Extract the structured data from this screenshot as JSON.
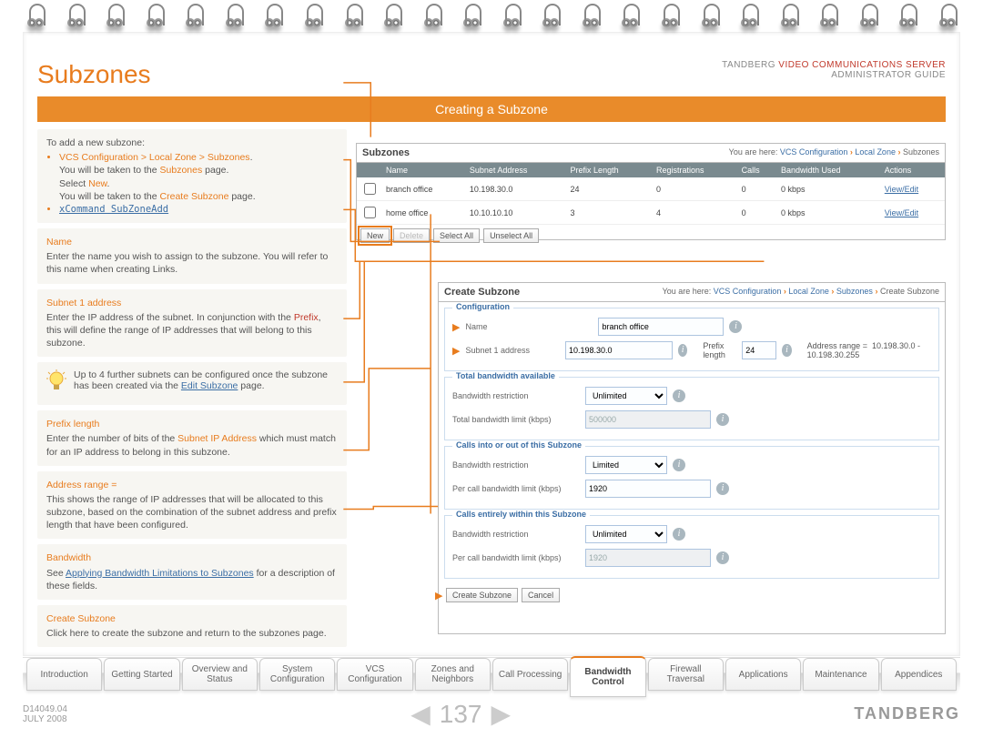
{
  "header": {
    "title": "Subzones",
    "product_line1a": "TANDBERG ",
    "product_line1b": "VIDEO COMMUNICATIONS SERVER",
    "product_line2": "ADMINISTRATOR GUIDE"
  },
  "banner": "Creating a Subzone",
  "intro": {
    "lead": "To add a new subzone:",
    "nav_path": "VCS Configuration > Local Zone > Subzones",
    "nav_path_after": ".",
    "line2a": "You will be taken to the ",
    "line2b": "Subzones",
    "line2c": " page.",
    "line3a": "Select ",
    "line3b": "New",
    "line3c": ".",
    "line4a": "You will be taken to the ",
    "line4b": "Create Subzone",
    "line4c": " page.",
    "xcommand": "xCommand SubZoneAdd"
  },
  "sections": {
    "name": {
      "title": "Name",
      "body": "Enter the name you wish to assign to the subzone.  You will refer to this name when creating Links."
    },
    "subnet": {
      "title": "Subnet 1 address",
      "body_a": "Enter the IP address of the subnet.  In conjunction with the ",
      "body_b": "Prefix",
      "body_c": ", this will define the range of IP addresses that will belong to this subzone."
    },
    "tip": {
      "body_a": "Up to 4 further subnets can be configured once the subzone has been created via the ",
      "body_link": "Edit Subzone",
      "body_b": " page."
    },
    "prefix": {
      "title": "Prefix length",
      "body_a": "Enter the number of bits of the ",
      "body_b": "Subnet IP Address",
      "body_c": " which must match for an IP address to belong in this subzone."
    },
    "range": {
      "title": "Address range =",
      "body": "This shows the range of IP addresses that will be allocated to this subzone, based on the combination of the subnet address and prefix length that have been configured."
    },
    "bandwidth": {
      "title": "Bandwidth",
      "body_a": "See ",
      "body_link": "Applying Bandwidth Limitations to Subzones",
      "body_b": " for a description of these fields."
    },
    "create": {
      "title": "Create Subzone",
      "body": "Click here to create the subzone and return to the subzones page."
    }
  },
  "panel_list": {
    "title": "Subzones",
    "crumb_prefix": "You are here: ",
    "crumb": [
      "VCS Configuration",
      "Local Zone",
      "Subzones"
    ],
    "cols": [
      "Name",
      "Subnet Address",
      "Prefix Length",
      "Registrations",
      "Calls",
      "Bandwidth Used",
      "Actions"
    ],
    "rows": [
      {
        "name": "branch office",
        "subnet": "10.198.30.0",
        "prefix": "24",
        "reg": "0",
        "calls": "0",
        "bw": "0 kbps",
        "action": "View/Edit"
      },
      {
        "name": "home office",
        "subnet": "10.10.10.10",
        "prefix": "3",
        "reg": "4",
        "calls": "0",
        "bw": "0 kbps",
        "action": "View/Edit"
      }
    ],
    "buttons": {
      "new": "New",
      "delete": "Delete",
      "select_all": "Select All",
      "unselect_all": "Unselect All"
    }
  },
  "panel_form": {
    "title": "Create Subzone",
    "crumb_prefix": "You are here: ",
    "crumb": [
      "VCS Configuration",
      "Local Zone",
      "Subzones",
      "Create Subzone"
    ],
    "groups": {
      "config": {
        "legend": "Configuration",
        "name_label": "Name",
        "name_value": "branch office",
        "subnet_label": "Subnet 1 address",
        "subnet_value": "10.198.30.0",
        "prefix_label": "Prefix length",
        "prefix_value": "24",
        "addr_label": "Address range =",
        "addr_value": "10.198.30.0 - 10.198.30.255"
      },
      "total": {
        "legend": "Total bandwidth available",
        "restrict_label": "Bandwidth restriction",
        "restrict_value": "Unlimited",
        "limit_label": "Total bandwidth limit (kbps)",
        "limit_value": "500000"
      },
      "calls_io": {
        "legend": "Calls into or out of this Subzone",
        "restrict_label": "Bandwidth restriction",
        "restrict_value": "Limited",
        "limit_label": "Per call bandwidth limit (kbps)",
        "limit_value": "1920"
      },
      "calls_within": {
        "legend": "Calls entirely within this Subzone",
        "restrict_label": "Bandwidth restriction",
        "restrict_value": "Unlimited",
        "limit_label": "Per call bandwidth limit (kbps)",
        "limit_value": "1920"
      }
    },
    "buttons": {
      "create": "Create Subzone",
      "cancel": "Cancel"
    }
  },
  "tabs": [
    "Introduction",
    "Getting Started",
    "Overview and Status",
    "System Configuration",
    "VCS Configuration",
    "Zones and Neighbors",
    "Call Processing",
    "Bandwidth Control",
    "Firewall Traversal",
    "Applications",
    "Maintenance",
    "Appendices"
  ],
  "active_tab_index": 7,
  "footer": {
    "doc": "D14049.04",
    "date": "JULY 2008",
    "page": "137",
    "brand": "TANDBERG"
  }
}
